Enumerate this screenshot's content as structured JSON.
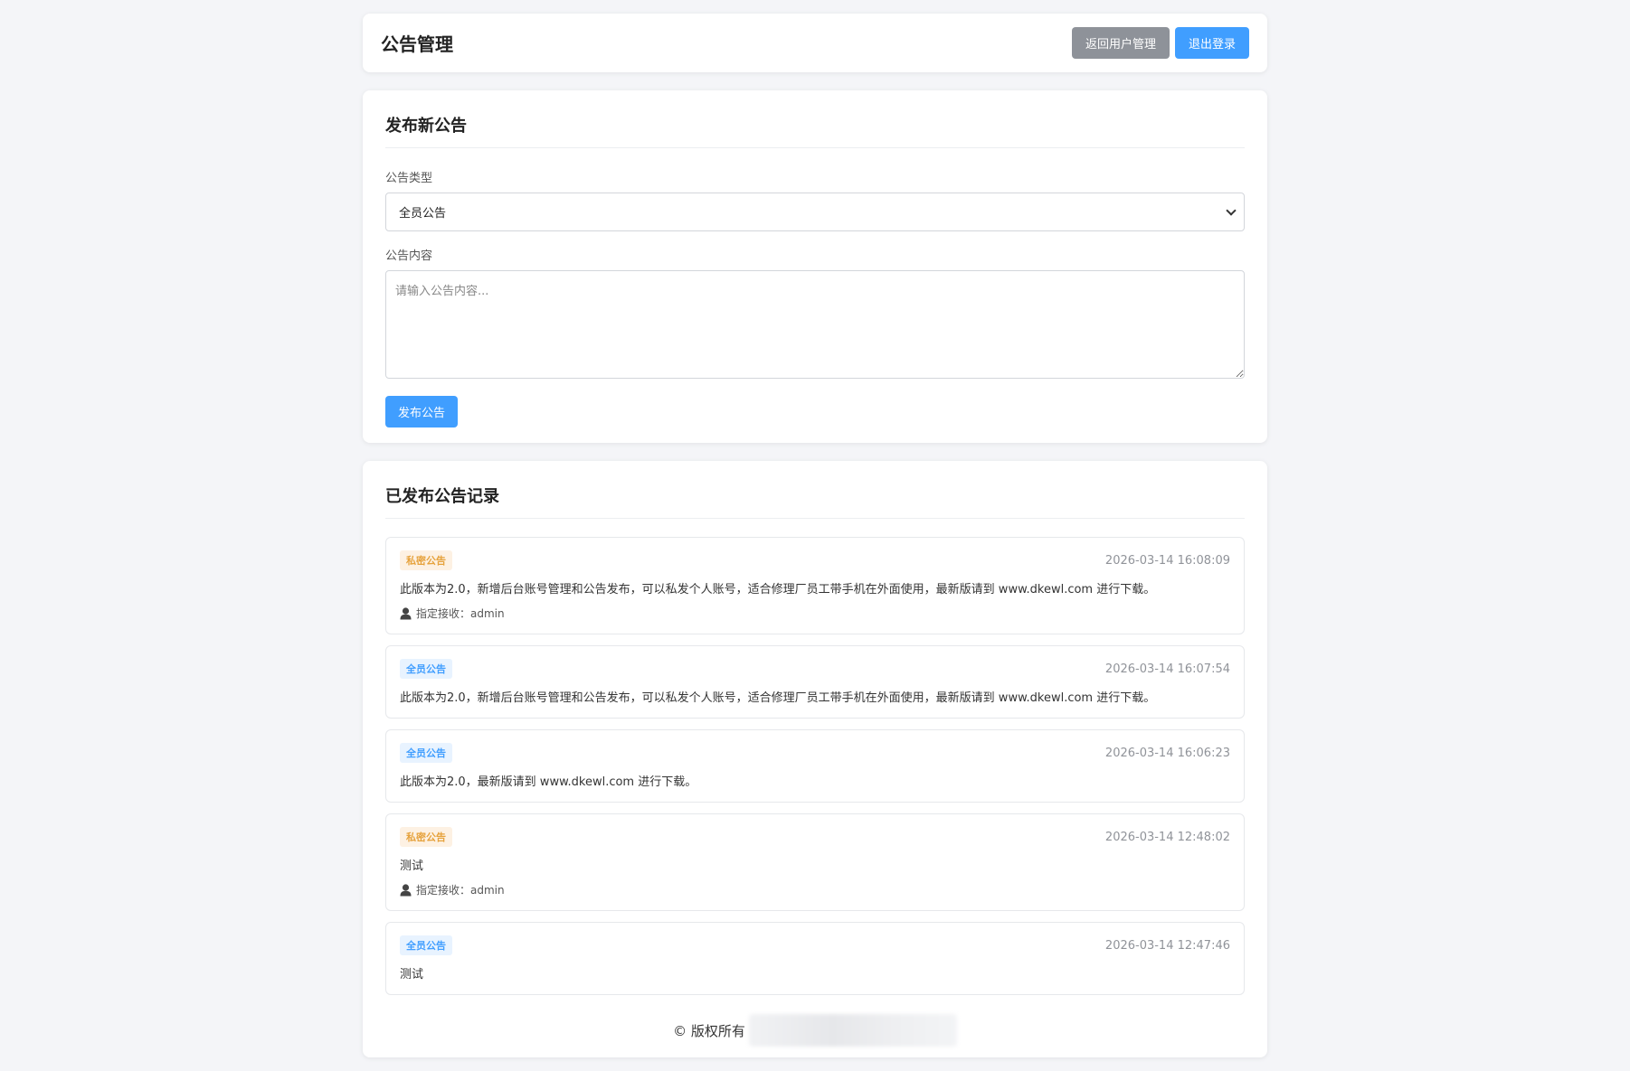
{
  "header": {
    "title": "公告管理",
    "back_label": "返回用户管理",
    "logout_label": "退出登录"
  },
  "publish": {
    "section_title": "发布新公告",
    "type_label": "公告类型",
    "type_value": "全员公告",
    "content_label": "公告内容",
    "content_placeholder": "请输入公告内容...",
    "submit_label": "发布公告"
  },
  "records": {
    "section_title": "已发布公告记录",
    "items": [
      {
        "badge": "私密公告",
        "kind": "private",
        "time": "2026-03-14 16:08:09",
        "content": "此版本为2.0，新增后台账号管理和公告发布，可以私发个人账号，适合修理厂员工带手机在外面使用，最新版请到 www.dkewl.com 进行下载。",
        "recipient": "指定接收：admin"
      },
      {
        "badge": "全员公告",
        "kind": "all",
        "time": "2026-03-14 16:07:54",
        "content": "此版本为2.0，新增后台账号管理和公告发布，可以私发个人账号，适合修理厂员工带手机在外面使用，最新版请到 www.dkewl.com 进行下载。"
      },
      {
        "badge": "全员公告",
        "kind": "all",
        "time": "2026-03-14 16:06:23",
        "content": "此版本为2.0，最新版请到 www.dkewl.com 进行下载。"
      },
      {
        "badge": "私密公告",
        "kind": "private",
        "time": "2026-03-14 12:48:02",
        "content": "测试",
        "recipient": "指定接收：admin"
      },
      {
        "badge": "全员公告",
        "kind": "all",
        "time": "2026-03-14 12:47:46",
        "content": "测试"
      }
    ]
  },
  "footer": {
    "copyright": "© 版权所有"
  },
  "colors": {
    "accent": "#409eff",
    "secondary_button": "#8e9299",
    "private_badge_text": "#e6a23c",
    "private_badge_bg": "#fdf1e3",
    "all_badge_text": "#409eff",
    "all_badge_bg": "#e8f3ff"
  },
  "icons": {
    "recipient": "user-icon",
    "select": "chevron-down-icon"
  }
}
